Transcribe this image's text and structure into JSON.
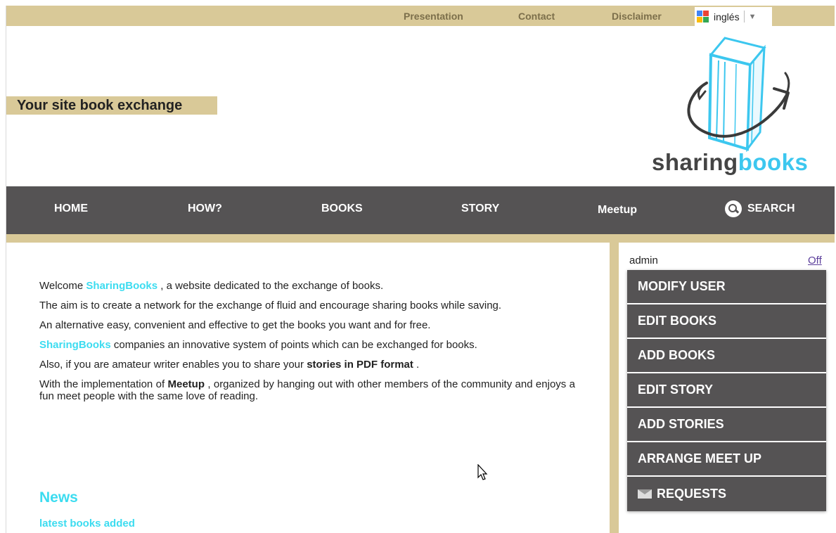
{
  "topbar": {
    "links": [
      "Presentation",
      "Contact",
      "Disclaimer"
    ],
    "language": "inglés"
  },
  "header": {
    "tagline": "Your site book exchange",
    "logo_text_a": "sharing",
    "logo_text_b": "books"
  },
  "nav": {
    "home": "HOME",
    "how": "HOW?",
    "books": "BOOKS",
    "story": "STORY",
    "meetup": "Meetup",
    "search": "SEARCH"
  },
  "content": {
    "p1_pre": "Welcome ",
    "p1_brand": "SharingBooks",
    "p1_post": " , a website dedicated to the exchange of books.",
    "p2": "The aim is to create a network for the exchange of fluid and encourage sharing books while saving.",
    "p3": "An alternative easy, convenient and effective to get the books you want and for free.",
    "p4_brand": "SharingBooks",
    "p4_post": " companies an innovative system of points which can be exchanged for books.",
    "p5_pre": "Also, if you are amateur writer enables you to share your ",
    "p5_bold": "stories in PDF format",
    "p5_post": " .",
    "p6_pre": "With the implementation of ",
    "p6_bold": "Meetup",
    "p6_post": " , organized by hanging out with other members of the community and enjoys a fun meet people with the same love of reading."
  },
  "news": {
    "title": "News",
    "subtitle": "latest books added"
  },
  "sidebar": {
    "user": "admin",
    "logout": "Off",
    "items": [
      "MODIFY USER",
      "EDIT BOOKS",
      "ADD BOOKS",
      "EDIT STORY",
      "ADD STORIES",
      "ARRANGE MEET UP",
      "REQUESTS"
    ]
  },
  "colors": {
    "tan": "#d9c998",
    "nav_gray": "#555354",
    "brand_cyan": "#3cdcf0",
    "logo_blue": "#3cc7ef"
  },
  "icons": [
    "google-translate-icon",
    "search-icon",
    "mail-icon",
    "book-logo-icon",
    "mouse-cursor-icon"
  ]
}
